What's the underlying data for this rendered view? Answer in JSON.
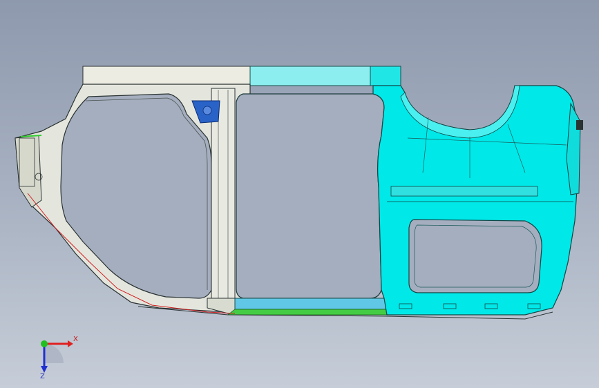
{
  "viewport": {
    "background_top": "#8e99ae",
    "background_bottom": "#c6cdd8"
  },
  "model": {
    "colors": {
      "selected_face": "#00e5e5",
      "selected_face_light": "#7ff0f0",
      "unselected_face": "#e6e8e0",
      "edge": "#1a3a3a",
      "highlight_part": "#2a63c8",
      "green_part": "#33cc33",
      "red_seam": "#d02020"
    }
  },
  "triad": {
    "x_label": "X",
    "z_label": "Z",
    "x_color": "#e02020",
    "y_color": "#20c020",
    "z_color": "#2030d0"
  }
}
